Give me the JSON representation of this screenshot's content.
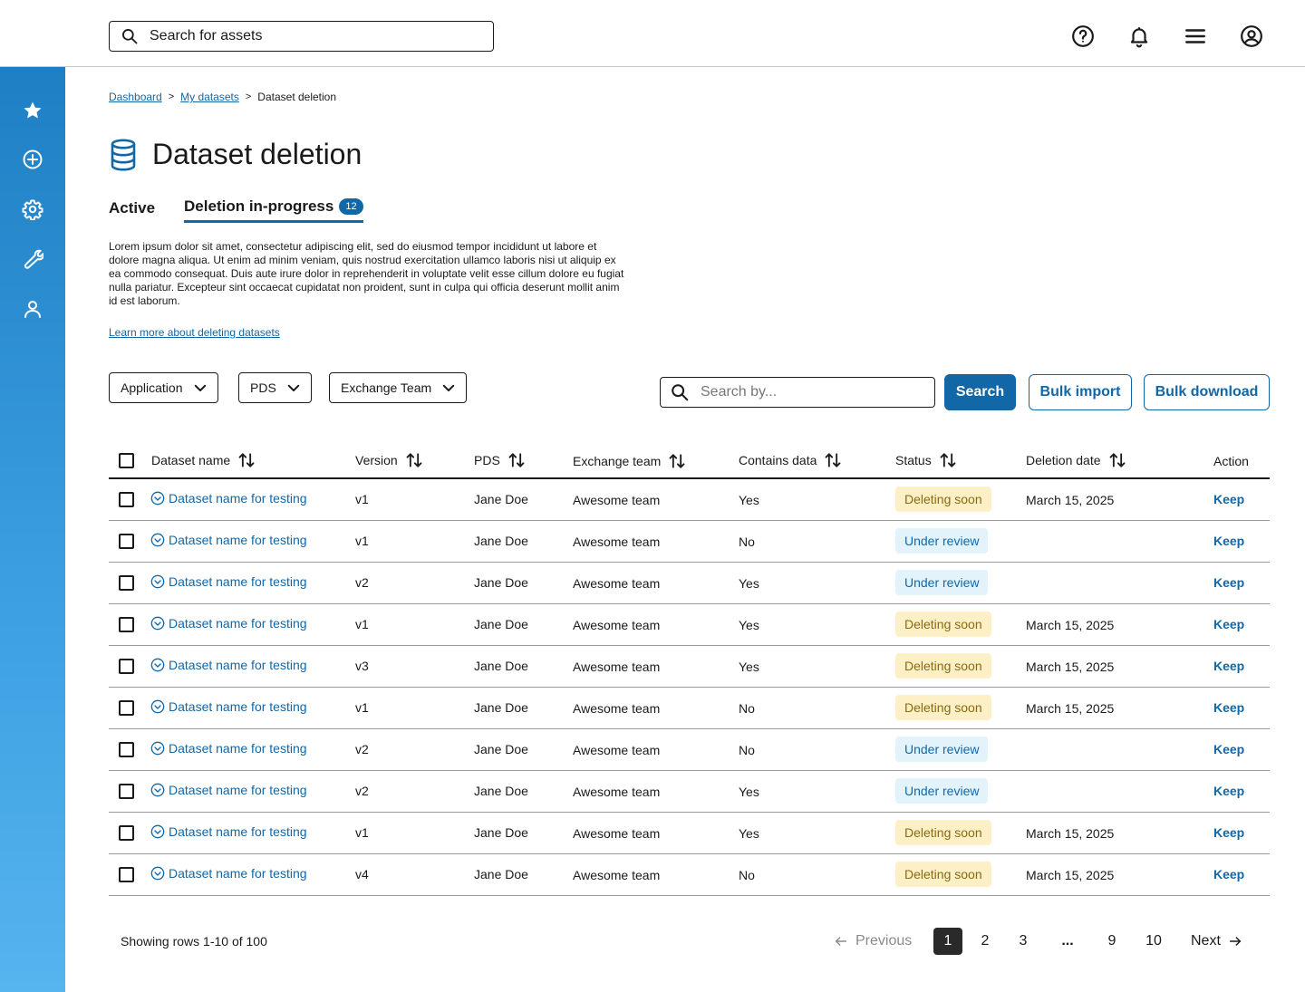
{
  "header": {
    "search_placeholder": "Search for assets",
    "icons": [
      "help-icon",
      "bell-icon",
      "menu-icon",
      "account-icon"
    ]
  },
  "sidebar": {
    "items": [
      {
        "name": "favorites",
        "icon": "star-icon"
      },
      {
        "name": "create",
        "icon": "plus-circle-icon"
      },
      {
        "name": "settings",
        "icon": "gear-icon"
      },
      {
        "name": "tools",
        "icon": "wrench-icon"
      },
      {
        "name": "profile",
        "icon": "user-icon"
      }
    ],
    "gradient": [
      "#1f7fc4",
      "#56b4ef"
    ]
  },
  "breadcrumb": {
    "items": [
      "Dashboard",
      "My datasets"
    ],
    "separator": ">",
    "current": "Dataset deletion"
  },
  "page": {
    "title": "Dataset deletion",
    "icon": "database-icon",
    "description": "Lorem ipsum dolor sit amet, consectetur adipiscing elit, sed do eiusmod tempor incididunt ut labore et dolore magna aliqua. Ut enim ad minim veniam, quis nostrud exercitation ullamco laboris nisi ut aliquip ex ea commodo consequat. Duis aute irure dolor in reprehenderit in voluptate velit esse cillum dolore eu fugiat nulla pariatur. Excepteur sint occaecat cupidatat non proident, sunt in culpa qui officia deserunt mollit anim id est laborum.",
    "learn_more": "Learn more about deleting datasets"
  },
  "tabs": [
    {
      "label": "Active",
      "active": false
    },
    {
      "label": "Deletion in-progress",
      "active": true,
      "badge": "12"
    }
  ],
  "filters": [
    "Application",
    "PDS",
    "Exchange Team"
  ],
  "toolbar": {
    "search_placeholder": "Search by...",
    "search_label": "Search",
    "bulk_import_label": "Bulk import",
    "bulk_download_label": "Bulk download"
  },
  "table": {
    "columns": [
      "Dataset name",
      "Version",
      "PDS",
      "Exchange team",
      "Contains data",
      "Status",
      "Deletion date",
      "Action"
    ],
    "rows": [
      {
        "name": "Dataset name for testing",
        "version": "v1",
        "pds": "Jane Doe",
        "team": "Awesome team",
        "contains": "Yes",
        "status": "Deleting soon",
        "date": "March 15, 2025",
        "action": "Keep"
      },
      {
        "name": "Dataset name for testing",
        "version": "v1",
        "pds": "Jane Doe",
        "team": "Awesome team",
        "contains": "No",
        "status": "Under review",
        "date": "",
        "action": "Keep"
      },
      {
        "name": "Dataset name for testing",
        "version": "v2",
        "pds": "Jane Doe",
        "team": "Awesome team",
        "contains": "Yes",
        "status": "Under review",
        "date": "",
        "action": "Keep"
      },
      {
        "name": "Dataset name for testing",
        "version": "v1",
        "pds": "Jane Doe",
        "team": "Awesome team",
        "contains": "Yes",
        "status": "Deleting soon",
        "date": "March 15, 2025",
        "action": "Keep"
      },
      {
        "name": "Dataset name for testing",
        "version": "v3",
        "pds": "Jane Doe",
        "team": "Awesome team",
        "contains": "Yes",
        "status": "Deleting soon",
        "date": "March 15, 2025",
        "action": "Keep"
      },
      {
        "name": "Dataset name for testing",
        "version": "v1",
        "pds": "Jane Doe",
        "team": "Awesome team",
        "contains": "No",
        "status": "Deleting soon",
        "date": "March 15, 2025",
        "action": "Keep"
      },
      {
        "name": "Dataset name for testing",
        "version": "v2",
        "pds": "Jane Doe",
        "team": "Awesome team",
        "contains": "No",
        "status": "Under review",
        "date": "",
        "action": "Keep"
      },
      {
        "name": "Dataset name for testing",
        "version": "v2",
        "pds": "Jane Doe",
        "team": "Awesome team",
        "contains": "Yes",
        "status": "Under review",
        "date": "",
        "action": "Keep"
      },
      {
        "name": "Dataset name for testing",
        "version": "v1",
        "pds": "Jane Doe",
        "team": "Awesome team",
        "contains": "Yes",
        "status": "Deleting soon",
        "date": "March 15, 2025",
        "action": "Keep"
      },
      {
        "name": "Dataset name for testing",
        "version": "v4",
        "pds": "Jane Doe",
        "team": "Awesome team",
        "contains": "No",
        "status": "Deleting soon",
        "date": "March 15, 2025",
        "action": "Keep"
      }
    ]
  },
  "pagination": {
    "rows_info": "Showing rows 1-10 of 100",
    "previous": "Previous",
    "next": "Next",
    "pages": [
      "1",
      "2",
      "3",
      "...",
      "9",
      "10"
    ],
    "current": "1"
  },
  "colors": {
    "accent": "#1267a6",
    "deleting_bg": "#fdf0c6",
    "deleting_text": "#8a6a10",
    "review_bg": "#e3f3fc",
    "review_text": "#1267a6"
  }
}
